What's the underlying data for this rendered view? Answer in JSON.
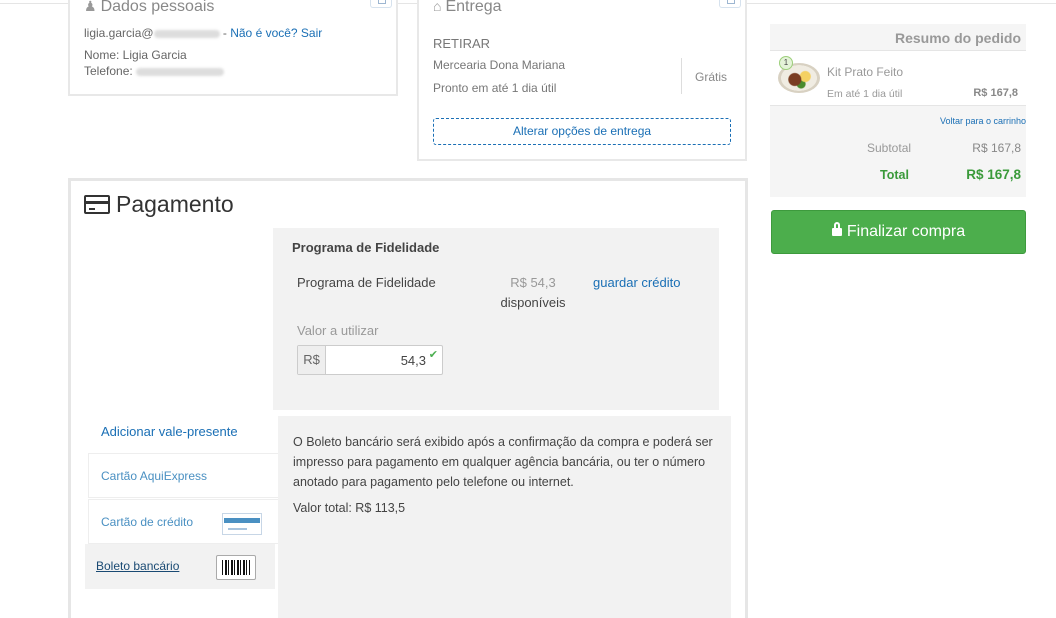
{
  "profile": {
    "title": "Dados pessoais",
    "email_prefix": "ligia.garcia@",
    "email_sep": " - ",
    "not_you": "Não é você? Sair",
    "name_line": "Nome: Ligia Garcia",
    "phone_label": "Telefone:"
  },
  "delivery": {
    "title": "Entrega",
    "method": "RETIRAR",
    "store": "Mercearia Dona Mariana",
    "eta": "Pronto em até 1 dia útil",
    "price": "Grátis",
    "change_button": "Alterar opções de entrega"
  },
  "payment": {
    "title": "Pagamento",
    "loyalty": {
      "heading": "Programa de Fidelidade",
      "name": "Programa de Fidelidade",
      "amount": "R$ 54,3",
      "available": "disponíveis",
      "save_credit": "guardar crédito",
      "value_label": "Valor a utilizar",
      "currency": "R$",
      "value": "54,3"
    },
    "add_gift": "Adicionar vale-presente",
    "methods": [
      {
        "label": "Cartão AquiExpress"
      },
      {
        "label": "Cartão de crédito"
      },
      {
        "label": "Boleto bancário"
      }
    ],
    "boleto_text": "O Boleto bancário será exibido após a confirmação da compra e poderá ser impresso para pagamento em qualquer agência bancária, ou ter o número anotado para pagamento pelo telefone ou internet.",
    "boleto_total": "Valor total: R$ 113,5"
  },
  "summary": {
    "title": "Resumo do pedido",
    "item": {
      "qty": "1",
      "name": "Kit Prato Feito",
      "eta": "Em até 1 dia útil",
      "price": "R$ 167,8"
    },
    "back_to_cart": "Voltar para o carrinho",
    "subtotal_label": "Subtotal",
    "subtotal_value": "R$ 167,8",
    "total_label": "Total",
    "total_value": "R$ 167,8",
    "checkout_button": "Finalizar compra"
  },
  "colors": {
    "link": "#1a6fb5",
    "success": "#4cae4c",
    "panel_bg": "#f2f2f2"
  },
  "icons": [
    "user-icon",
    "home-icon",
    "edit-icon",
    "credit-card-icon",
    "check-icon",
    "barcode-icon",
    "lock-icon"
  ]
}
